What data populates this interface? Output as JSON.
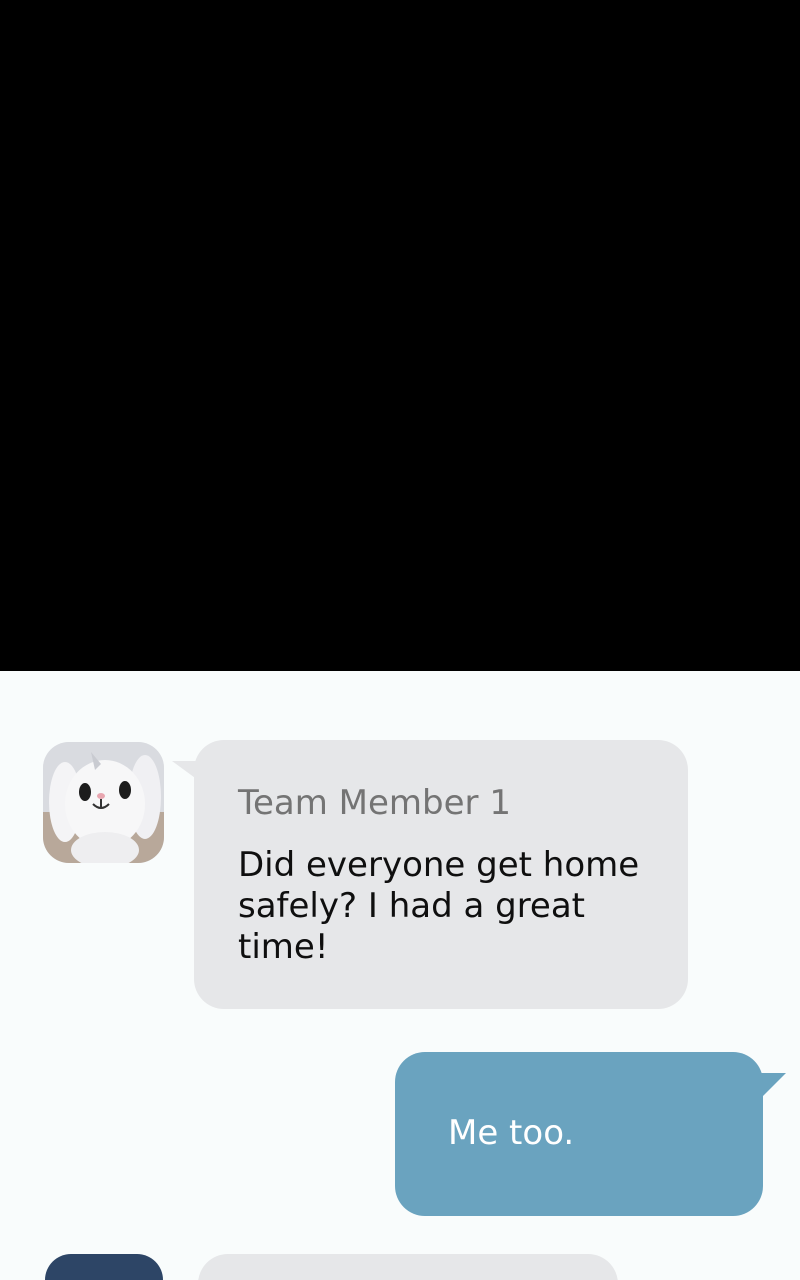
{
  "messages": [
    {
      "sender": "Team Member 1",
      "text": "Did everyone get home safely? I had a great time!",
      "direction": "incoming",
      "avatar_icon": "bunny-plush-avatar"
    },
    {
      "text": "Me too.",
      "direction": "outgoing"
    }
  ],
  "colors": {
    "top_panel": "#000000",
    "background": "#f9fcfc",
    "incoming_bubble": "#e6e7e9",
    "outgoing_bubble": "#6aa3bf",
    "sender_name": "#747474",
    "incoming_text": "#0f0f0f",
    "outgoing_text": "#ffffff"
  }
}
